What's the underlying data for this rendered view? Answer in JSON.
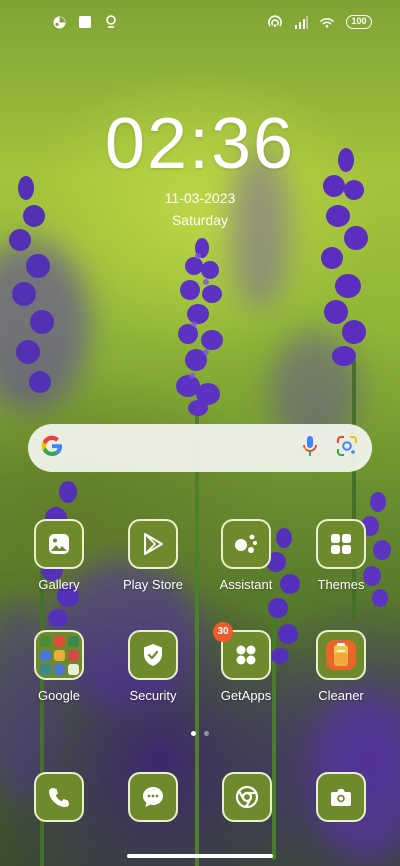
{
  "status_bar": {
    "left_icons": [
      "notification-app-icon",
      "notification-square-icon",
      "location-pin-icon"
    ],
    "right_icons": [
      "hotspot-icon",
      "signal-icon",
      "wifi-icon"
    ],
    "battery": "100"
  },
  "clock": {
    "time": "02:36",
    "date": "11-03-2023",
    "day": "Saturday"
  },
  "search": {
    "logo": "G",
    "icons": [
      "google-logo-icon",
      "microphone-icon",
      "lens-icon"
    ]
  },
  "apps": [
    {
      "label": "Gallery",
      "icon": "gallery-icon"
    },
    {
      "label": "Play Store",
      "icon": "play-store-icon"
    },
    {
      "label": "Assistant",
      "icon": "assistant-icon"
    },
    {
      "label": "Themes",
      "icon": "themes-icon"
    },
    {
      "label": "Google",
      "icon": "folder-icon"
    },
    {
      "label": "Security",
      "icon": "shield-icon"
    },
    {
      "label": "GetApps",
      "icon": "getapps-icon",
      "badge": "30"
    },
    {
      "label": "Cleaner",
      "icon": "cleaner-icon"
    }
  ],
  "dock": [
    {
      "icon": "phone-icon"
    },
    {
      "icon": "messages-icon"
    },
    {
      "icon": "chrome-icon"
    },
    {
      "icon": "camera-icon"
    }
  ],
  "colors": {
    "icon_bg": "#6f8a2d",
    "badge": "#ee5a2c",
    "search_bg": "#f4f6f0"
  }
}
